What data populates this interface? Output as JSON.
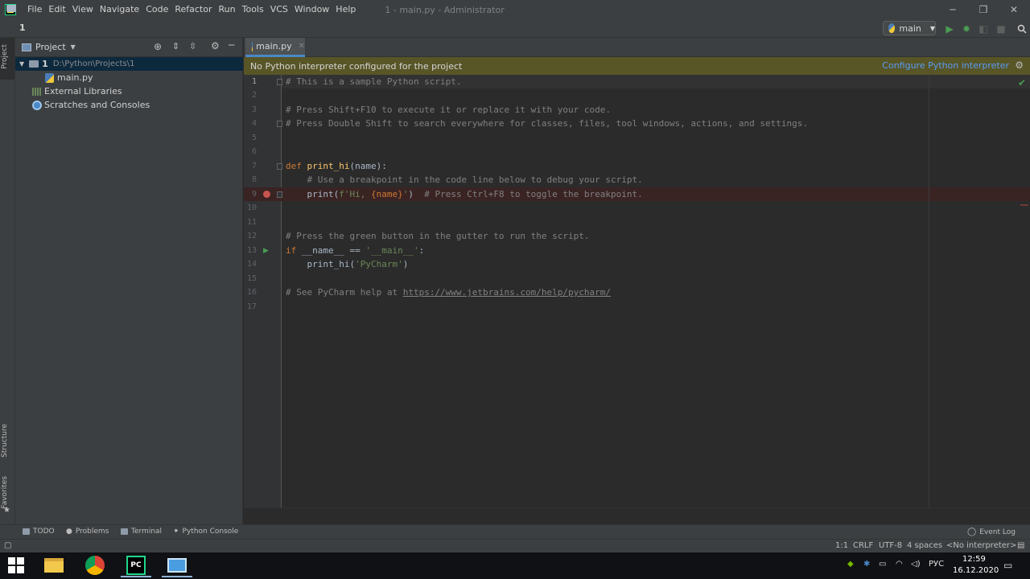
{
  "menu": [
    "File",
    "Edit",
    "View",
    "Navigate",
    "Code",
    "Refactor",
    "Run",
    "Tools",
    "VCS",
    "Window",
    "Help"
  ],
  "window_title": "1 - main.py - Administrator",
  "window_controls": {
    "minimize": "─",
    "maximize": "❐",
    "close": "✕"
  },
  "navbar": {
    "breadcrumb": "1",
    "run_config": "main"
  },
  "left_stripe": {
    "project": "Project",
    "structure": "Structure",
    "favorites": "Favorites"
  },
  "project_panel": {
    "title": "Project",
    "root_name": "1",
    "root_path": "D:\\Python\\Projects\\1",
    "items": [
      "main.py",
      "External Libraries",
      "Scratches and Consoles"
    ]
  },
  "editor": {
    "tab": "main.py",
    "banner_text": "No Python interpreter configured for the project",
    "banner_link": "Configure Python interpreter",
    "line_numbers": [
      "1",
      "2",
      "3",
      "4",
      "5",
      "6",
      "7",
      "8",
      "9",
      "10",
      "11",
      "12",
      "13",
      "14",
      "15",
      "16",
      "17"
    ],
    "code": {
      "l1": "# This is a sample Python script.",
      "l3": "# Press Shift+F10 to execute it or replace it with your code.",
      "l4": "# Press Double Shift to search everywhere for classes, files, tool windows, actions, and settings.",
      "l7_kw": "def",
      "l7_fn": "print_hi",
      "l7_rest": "(name):",
      "l8": "    # Use a breakpoint in the code line below to debug your script.",
      "l9_a": "    print(",
      "l9_str1": "f'Hi, ",
      "l9_b": "{name}",
      "l9_str2": "'",
      "l9_c": ")  ",
      "l9_cm": "# Press Ctrl+F8 to toggle the breakpoint.",
      "l12": "# Press the green button in the gutter to run the script.",
      "l13_kw": "if",
      "l13_a": " __name__ == ",
      "l13_str": "'__main__'",
      "l13_b": ":",
      "l14_a": "    print_hi(",
      "l14_str": "'PyCharm'",
      "l14_b": ")",
      "l16_a": "# See PyCharm help at ",
      "l16_link": "https://www.jetbrains.com/help/pycharm/"
    }
  },
  "bottom_tools": [
    "TODO",
    "Problems",
    "Terminal",
    "Python Console"
  ],
  "event_log": "Event Log",
  "status": {
    "position": "1:1",
    "line_sep": "CRLF",
    "encoding": "UTF-8",
    "indent": "4 spaces",
    "interpreter": "<No interpreter>"
  },
  "taskbar": {
    "lang": "РУС",
    "time": "12:59",
    "date": "16.12.2020"
  }
}
